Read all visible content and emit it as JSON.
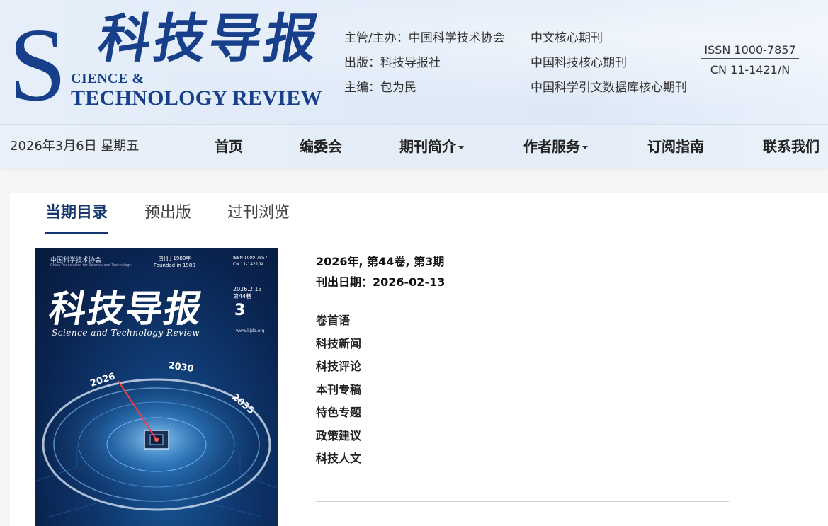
{
  "header": {
    "logo": {
      "s_letter": "S",
      "title_cn": "科技导报",
      "en_line1": "CIENCE &",
      "en_line2": "TECHNOLOGY REVIEW"
    },
    "info_left": [
      "主管/主办：中国科学技术协会",
      "出版：科技导报社",
      "主编：包为民"
    ],
    "info_right": [
      "中文核心期刊",
      "中国科技核心期刊",
      "中国科学引文数据库核心期刊"
    ],
    "issn": "ISSN 1000-7857",
    "cn": "CN 11-1421/N"
  },
  "nav": {
    "date": "2026年3月6日 星期五",
    "items": [
      {
        "label": "首页"
      },
      {
        "label": "编委会"
      },
      {
        "label": "期刊简介"
      },
      {
        "label": "作者服务"
      },
      {
        "label": "订阅指南"
      },
      {
        "label": "联系我们"
      }
    ]
  },
  "tabs": [
    {
      "label": "当期目录",
      "active": true
    },
    {
      "label": "预出版",
      "active": false
    },
    {
      "label": "过刊浏览",
      "active": false
    }
  ],
  "cover": {
    "publisher": "中国科学技术协会",
    "publisher_en": "China Association for Science and Technology",
    "founded_cn": "创刊于1980年",
    "founded_en": "Founded in 1980",
    "issn": "ISSN 1000-7857",
    "cn": "CN 11-1421/N",
    "title": "科技导报",
    "date": "2026.2.13",
    "volume": "第44卷",
    "issue_no": "3",
    "subtitle": "Science and Technology Review",
    "url": "www.kjdb.org",
    "dial_years": [
      "2026",
      "2030",
      "2035"
    ]
  },
  "issue": {
    "volume_line": "2026年, 第44卷, 第3期",
    "pub_date": "刊出日期：2026-02-13"
  },
  "sections": [
    "卷首语",
    "科技新闻",
    "科技评论",
    "本刊专稿",
    "特色专题",
    "政策建议",
    "科技人文"
  ]
}
